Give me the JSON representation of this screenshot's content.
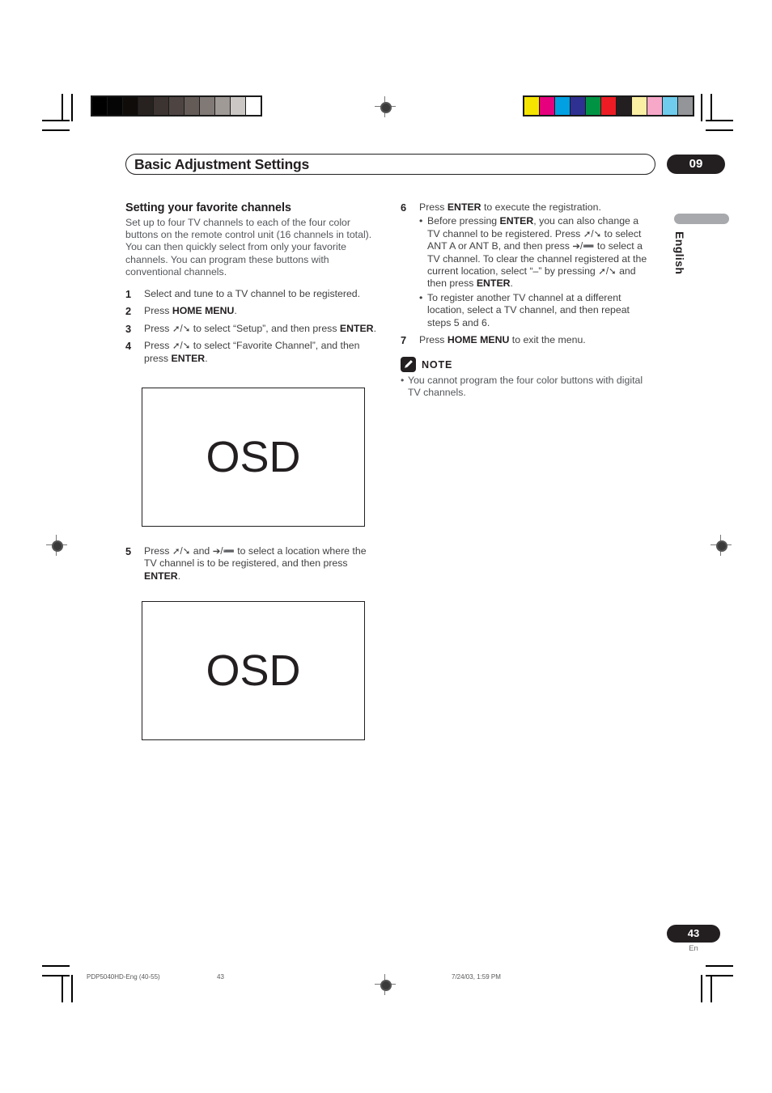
{
  "header": {
    "title": "Basic Adjustment Settings",
    "chapter_badge": "09"
  },
  "side_tab": {
    "language": "English"
  },
  "left_column": {
    "section_title": "Setting your favorite channels",
    "intro": "Set up to four TV channels to each of the four color buttons on the remote control unit (16 channels in total). You can then quickly select from only your favorite channels. You can program these buttons with conventional channels.",
    "steps": [
      {
        "num": "1",
        "html": "Select and tune to a TV channel to be registered."
      },
      {
        "num": "2",
        "html": "Press <span class=\"b\">HOME MENU</span>."
      },
      {
        "num": "3",
        "html": "Press <span class=\"arrow\">&#10138;/&#10136;</span> to select &ldquo;Setup&rdquo;, and then press <span class=\"b\">ENTER</span>."
      },
      {
        "num": "4",
        "html": "Press <span class=\"arrow\">&#10138;/&#10136;</span> to select &ldquo;Favorite Channel&rdquo;, and then press <span class=\"b\">ENTER</span>."
      }
    ],
    "step5": {
      "num": "5",
      "html": "Press <span class=\"arrow\">&#10138;/&#10136;</span> and <span class=\"arrow\">&#10132;/&#10134;</span> to select a location where the TV channel is to be registered, and then press <span class=\"b\">ENTER</span>."
    }
  },
  "osd_screens": [
    {
      "label": "OSD"
    },
    {
      "label": "OSD"
    }
  ],
  "right_column": {
    "steps": [
      {
        "num": "6",
        "html": "Press <span class=\"b\">ENTER</span> to execute the registration.",
        "sub": [
          "Before pressing <span class=\"b\">ENTER</span>, you can also change a TV channel to be registered. Press <span class=\"arrow\">&#10138;/&#10136;</span> to select ANT A or ANT B, and then press <span class=\"arrow\">&#10132;/&#10134;</span> to select a TV channel. To clear the channel registered at the current location, select &ldquo;&ndash;&rdquo; by pressing <span class=\"arrow\">&#10138;/&#10136;</span> and then press <span class=\"b\">ENTER</span>.",
          "To register another TV channel at a different location, select a TV channel, and then repeat steps 5 and 6."
        ]
      },
      {
        "num": "7",
        "html": "Press <span class=\"b\">HOME MENU</span> to exit the menu.",
        "sub": []
      }
    ],
    "note": {
      "title": "NOTE",
      "items": [
        "You cannot program the four color buttons with digital TV channels."
      ]
    }
  },
  "page_footer": {
    "page_badge": "43",
    "page_language": "En",
    "print_file": "PDP5040HD-Eng (40-55)",
    "print_page": "43",
    "print_date": "7/24/03, 1:59 PM"
  },
  "calibration": {
    "grayscale_label": "grayscale-calibration-bar",
    "grayscale_swatches": [
      "#000000",
      "#050505",
      "#0f0c0a",
      "#272220",
      "#3c3431",
      "#4e4542",
      "#645b57",
      "#817976",
      "#a09a97",
      "#cbc7c5",
      "#ffffff"
    ],
    "color_label": "color-calibration-bar",
    "color_swatches": [
      "#f5e400",
      "#e6007e",
      "#00a0e2",
      "#2e3192",
      "#009344",
      "#ed1c24",
      "#231f20",
      "#fbefa4",
      "#f7a8c8",
      "#6fcced",
      "#939598"
    ]
  }
}
